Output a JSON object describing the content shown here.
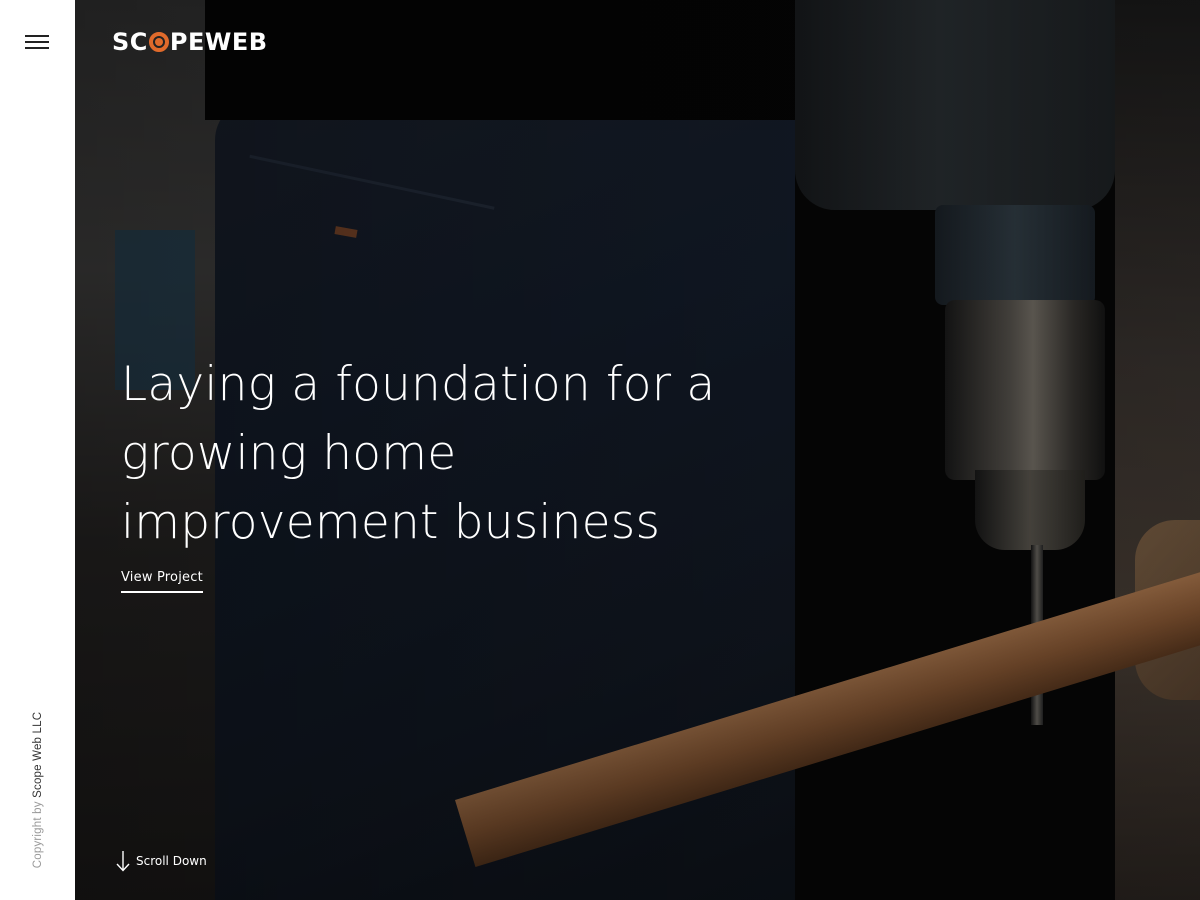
{
  "brand": {
    "logo_prefix": "SC",
    "logo_suffix": "PEWEB",
    "accent_color": "#e06a2b"
  },
  "sidebar": {
    "menu_icon": "hamburger-menu-icon",
    "copyright_prefix": "Copyright by",
    "copyright_owner": "Scope Web LLC"
  },
  "hero": {
    "headline": "Laying a foundation for a growing home improvement business",
    "cta_label": "View Project",
    "scroll_label": "Scroll Down",
    "scroll_icon": "arrow-down-icon"
  }
}
